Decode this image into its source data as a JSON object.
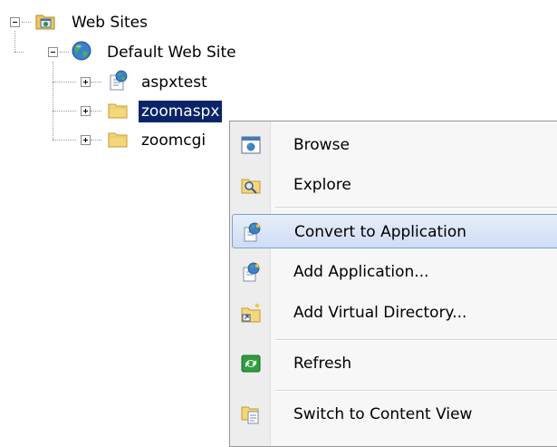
{
  "tree": {
    "root": {
      "label": "Web Sites",
      "icon": "web-sites-folder-icon"
    },
    "site": {
      "label": "Default Web Site",
      "icon": "globe-icon"
    },
    "children": [
      {
        "label": "aspxtest",
        "icon": "application-icon",
        "selected": false
      },
      {
        "label": "zoomaspx",
        "icon": "folder-icon",
        "selected": true
      },
      {
        "label": "zoomcgi",
        "icon": "folder-icon",
        "selected": false
      }
    ]
  },
  "context_menu": {
    "items": [
      {
        "label": "Browse",
        "icon": "browse-icon"
      },
      {
        "label": "Explore",
        "icon": "explore-icon"
      },
      {
        "label": "Convert to Application",
        "icon": "convert-app-icon",
        "highlighted": true
      },
      {
        "label": "Add Application...",
        "icon": "add-app-icon"
      },
      {
        "label": "Add Virtual Directory...",
        "icon": "add-vdir-icon"
      },
      {
        "label": "Refresh",
        "icon": "refresh-icon"
      },
      {
        "label": "Switch to Content View",
        "icon": "content-view-icon"
      }
    ]
  },
  "colors": {
    "selection": "#0a246a",
    "menu_highlight_border": "#7da2ce",
    "folder": "#f5d77b"
  }
}
